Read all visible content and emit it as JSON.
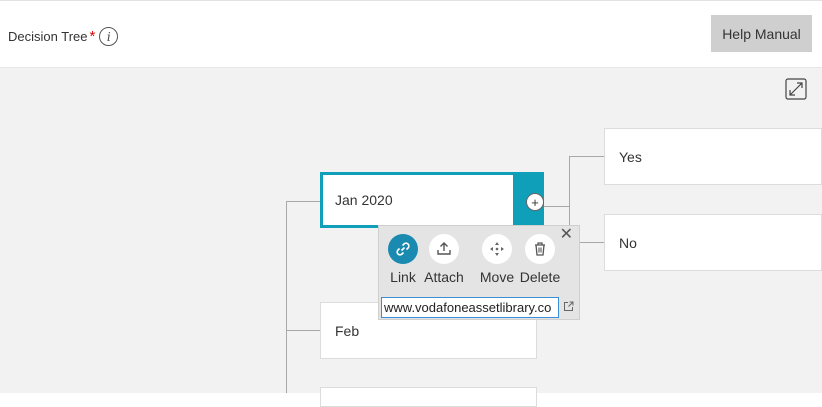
{
  "header": {
    "title": "Decision Tree",
    "required_mark": "*",
    "info_icon_glyph": "i",
    "help_button_label": "Help Manual"
  },
  "tree": {
    "selected_node": "Jan 2020",
    "children": [
      "Yes",
      "No"
    ],
    "siblings": [
      "Feb"
    ]
  },
  "popup": {
    "close_glyph": "✕",
    "tools": [
      {
        "label": "Link",
        "icon": "link-icon"
      },
      {
        "label": "Attach",
        "icon": "upload-icon"
      },
      {
        "label": "Move",
        "icon": "move-icon"
      },
      {
        "label": "Delete",
        "icon": "trash-icon"
      }
    ],
    "url_value": "www.vodafoneassetlibrary.co"
  },
  "colors": {
    "accent": "#0f9fb8",
    "link_active": "#1a8ab0",
    "required": "#e60000"
  }
}
